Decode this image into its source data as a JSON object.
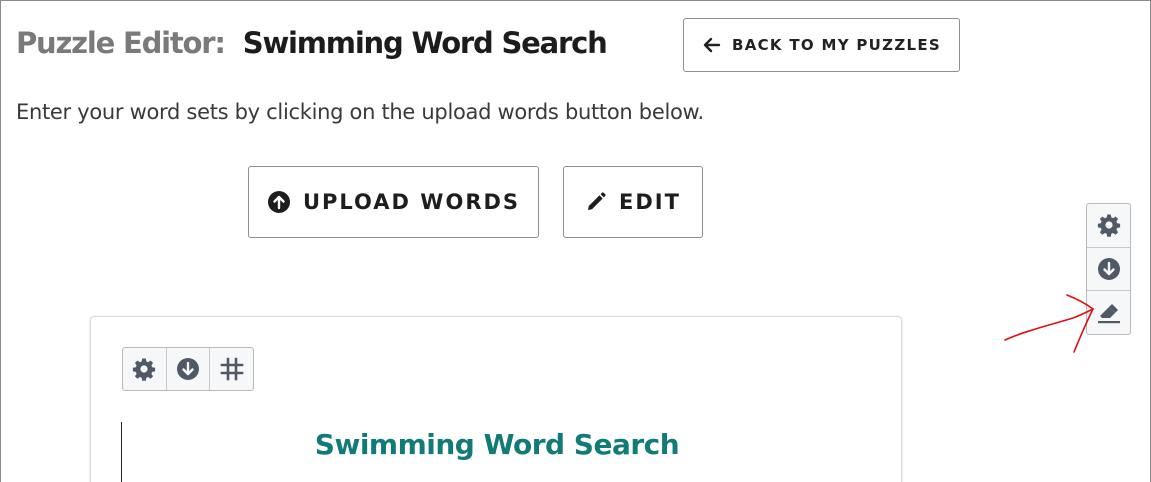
{
  "header": {
    "title_prefix": "Puzzle Editor:",
    "title_name": "Swimming Word Search",
    "back_button_label": "BACK TO MY PUZZLES"
  },
  "instructions": "Enter your word sets by clicking on the upload words button below.",
  "actions": {
    "upload_label": "UPLOAD WORDS",
    "edit_label": "EDIT"
  },
  "side_toolbar": {
    "items": [
      {
        "icon": "gear-icon"
      },
      {
        "icon": "download-icon"
      },
      {
        "icon": "eraser-icon"
      }
    ]
  },
  "card": {
    "toolbar": [
      {
        "icon": "gear-icon"
      },
      {
        "icon": "download-icon"
      },
      {
        "icon": "grid-icon"
      }
    ],
    "puzzle_title": "Swimming Word Search"
  },
  "colors": {
    "title_prefix": "#7a7a7a",
    "puzzle_title": "#127b77",
    "icon": "#4f5a66",
    "annotation": "#e01010"
  }
}
